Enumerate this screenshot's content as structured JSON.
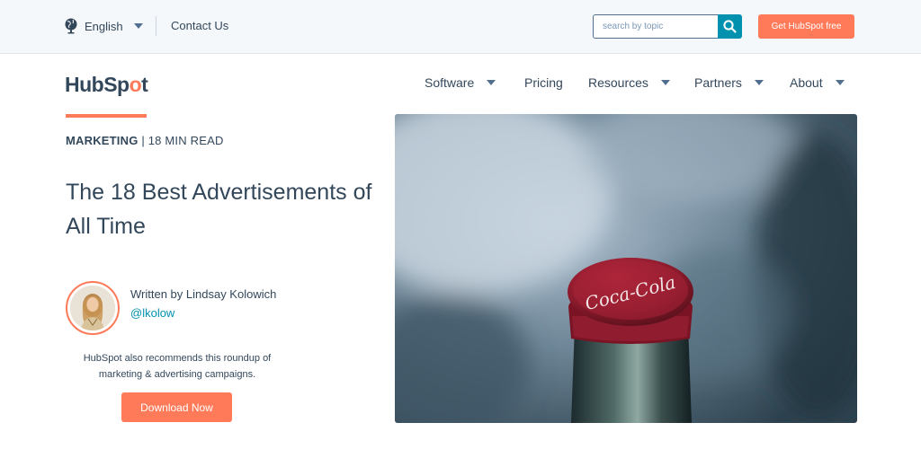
{
  "utility_bar": {
    "language": "English",
    "contact": "Contact Us",
    "search_placeholder": "search by topic",
    "cta": "Get HubSpot free"
  },
  "brand": {
    "logo_prefix": "HubSp",
    "logo_accent": "o",
    "logo_suffix": "t",
    "accent_color": "#ff7a59",
    "link_color": "#0091ae",
    "text_color": "#33475b"
  },
  "nav": {
    "items": [
      {
        "label": "Software",
        "dropdown": true
      },
      {
        "label": "Pricing",
        "dropdown": false
      },
      {
        "label": "Resources",
        "dropdown": true
      },
      {
        "label": "Partners",
        "dropdown": true
      },
      {
        "label": "About",
        "dropdown": true
      }
    ]
  },
  "article": {
    "topic": "MARKETING",
    "separator": "|",
    "read_time": "18 MIN READ",
    "title": "The 18 Best Advertisements of All Time",
    "author_line": "Written by Lindsay Kolowich",
    "author_handle": "@lkolow",
    "recommend_text": "HubSpot also recommends this roundup of marketing & advertising campaigns.",
    "download_label": "Download Now",
    "image_caption_text": "Coca-Cola"
  },
  "icons": {
    "language": "globe-icon",
    "search": "search-icon",
    "dropdown": "caret-down-icon"
  }
}
